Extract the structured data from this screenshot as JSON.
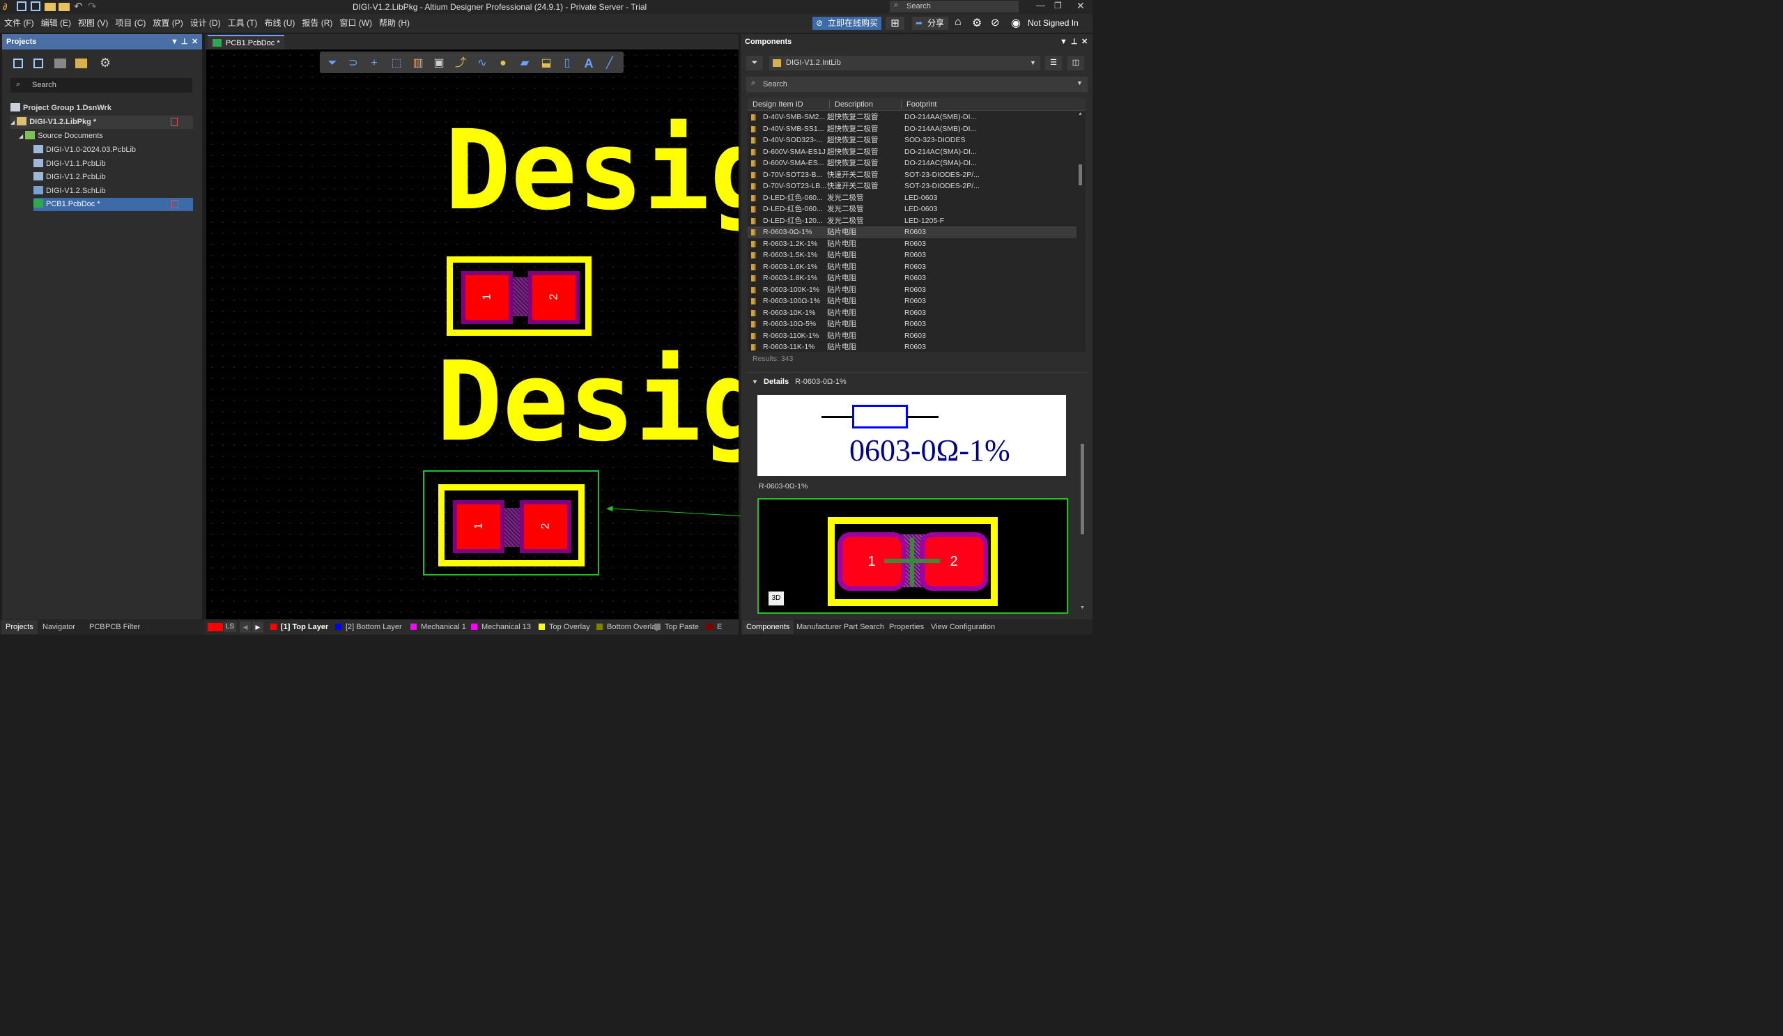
{
  "window": {
    "title": "DIGI-V1.2.LibPkg - Altium Designer Professional (24.9.1) - Private Server - Trial",
    "search_placeholder": "Search"
  },
  "menu": [
    "文件 (F)",
    "编辑 (E)",
    "视图 (V)",
    "项目 (C)",
    "放置 (P)",
    "设计 (D)",
    "工具 (T)",
    "布线 (U)",
    "报告 (R)",
    "窗口 (W)",
    "帮助 (H)"
  ],
  "topright": {
    "buy_label": "立即在线购买",
    "share_label": "分享",
    "user_label": "Not Signed In"
  },
  "projects": {
    "title": "Projects",
    "search_placeholder": "Search",
    "group": "Project Group 1.DsnWrk",
    "project": "DIGI-V1.2.LibPkg *",
    "folder": "Source Documents",
    "files": [
      "DIGI-V1.0-2024.03.PcbLib",
      "DIGI-V1.1.PcbLib",
      "DIGI-V1.2.PcbLib",
      "DIGI-V1.2.SchLib",
      "PCB1.PcbDoc *"
    ]
  },
  "left_tabs": [
    "Projects",
    "Navigator",
    "PCB",
    "PCB Filter"
  ],
  "doc_tab": "PCB1.PcbDoc *",
  "canvas": {
    "text1": "Desig",
    "text2": "Desig",
    "pad1": "1",
    "pad2": "2"
  },
  "layers": {
    "ls": "LS",
    "items": [
      {
        "label": "[1] Top Layer",
        "color": "#ff0000"
      },
      {
        "label": "[2] Bottom Layer",
        "color": "#0000ff"
      },
      {
        "label": "Mechanical 1",
        "color": "#ff00ff"
      },
      {
        "label": "Mechanical 13",
        "color": "#ff00ff"
      },
      {
        "label": "Top Overlay",
        "color": "#ffff00"
      },
      {
        "label": "Bottom Overlay",
        "color": "#808000"
      },
      {
        "label": "Top Paste",
        "color": "#808080"
      },
      {
        "label": "E",
        "color": "#800000"
      }
    ]
  },
  "components": {
    "title": "Components",
    "library": "DIGI-V1.2.IntLib",
    "search_placeholder": "Search",
    "columns": [
      "Design Item ID",
      "Description",
      "Footprint"
    ],
    "rows": [
      [
        "D-40V-SMB-SM2...",
        "超快恢复二极管",
        "DO-214AA(SMB)-DI..."
      ],
      [
        "D-40V-SMB-SS1...",
        "超快恢复二极管",
        "DO-214AA(SMB)-DI..."
      ],
      [
        "D-40V-SOD323-...",
        "超快恢复二极管",
        "SOD-323-DIODES"
      ],
      [
        "D-600V-SMA-ES1J",
        "超快恢复二极管",
        "DO-214AC(SMA)-DI..."
      ],
      [
        "D-600V-SMA-ES...",
        "超快恢复二极管",
        "DO-214AC(SMA)-DI..."
      ],
      [
        "D-70V-SOT23-B...",
        "快速开关二极管",
        "SOT-23-DIODES-2P/..."
      ],
      [
        "D-70V-SOT23-LB...",
        "快速开关二极管",
        "SOT-23-DIODES-2P/..."
      ],
      [
        "D-LED-红色-060...",
        "发光二极管",
        "LED-0603"
      ],
      [
        "D-LED-红色-060...",
        "发光二极管",
        "LED-0603"
      ],
      [
        "D-LED-红色-120...",
        "发光二极管",
        "LED-1205-F"
      ],
      [
        "R-0603-0Ω-1%",
        "贴片电阻",
        "R0603"
      ],
      [
        "R-0603-1.2K-1%",
        "贴片电阻",
        "R0603"
      ],
      [
        "R-0603-1.5K-1%",
        "贴片电阻",
        "R0603"
      ],
      [
        "R-0603-1.6K-1%",
        "贴片电阻",
        "R0603"
      ],
      [
        "R-0603-1.8K-1%",
        "贴片电阻",
        "R0603"
      ],
      [
        "R-0603-100K-1%",
        "贴片电阻",
        "R0603"
      ],
      [
        "R-0603-100Ω-1%",
        "贴片电阻",
        "R0603"
      ],
      [
        "R-0603-10K-1%",
        "贴片电阻",
        "R0603"
      ],
      [
        "R-0603-10Ω-5%",
        "贴片电阻",
        "R0603"
      ],
      [
        "R-0603-110K-1%",
        "贴片电阻",
        "R0603"
      ],
      [
        "R-0603-11K-1%",
        "贴片电阻",
        "R0603"
      ]
    ],
    "selected_index": 10,
    "results": "Results: 343",
    "details_label": "Details",
    "details_name": "R-0603-0Ω-1%",
    "symbol_text": "0603-0Ω-1%",
    "model_name": "R-0603-0Ω-1%",
    "badge_3d": "3D",
    "fp_pad1": "1",
    "fp_pad2": "2"
  },
  "right_tabs": [
    "Components",
    "Manufacturer Part Search",
    "Properties",
    "View Configuration"
  ]
}
